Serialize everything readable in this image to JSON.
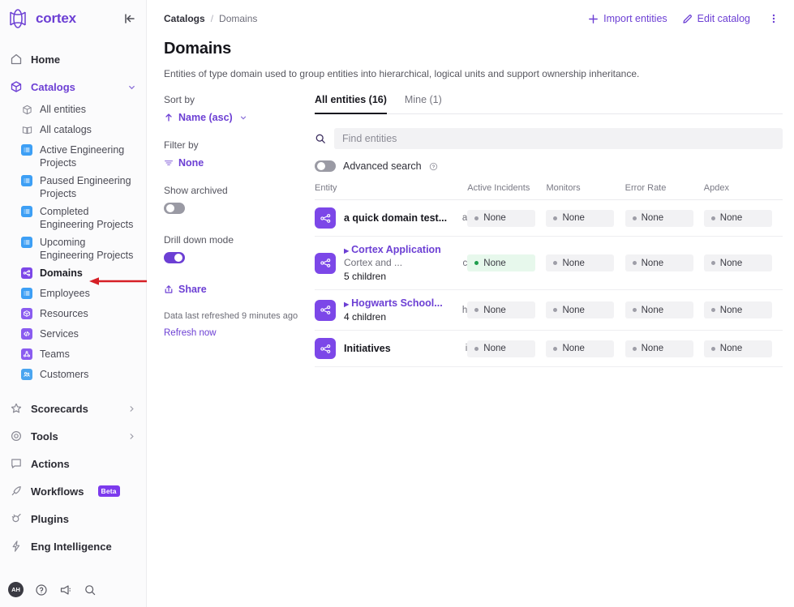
{
  "brand": {
    "name": "cortex",
    "collapse_icon": "collapse-left-icon"
  },
  "sidebar": {
    "home": {
      "label": "Home",
      "icon": "home-icon"
    },
    "catalogs": {
      "label": "Catalogs",
      "icon": "cube-icon",
      "chevron": "chevron-down-icon"
    },
    "catalog_items": [
      {
        "label": "All entities",
        "icon": "cube-outline-icon",
        "color": "none"
      },
      {
        "label": "All catalogs",
        "icon": "book-icon",
        "color": "none"
      },
      {
        "label": "Active Engineering Projects",
        "icon": "list-icon",
        "color": "#3d9ff5"
      },
      {
        "label": "Paused Engineering Projects",
        "icon": "list-icon",
        "color": "#3d9ff5"
      },
      {
        "label": "Completed Engineering Projects",
        "icon": "list-icon",
        "color": "#3d9ff5"
      },
      {
        "label": "Upcoming Engineering Projects",
        "icon": "list-icon",
        "color": "#3d9ff5"
      },
      {
        "label": "Domains",
        "icon": "domain-icon",
        "color": "#7c47e8"
      },
      {
        "label": "Employees",
        "icon": "list-icon",
        "color": "#3d9ff5"
      },
      {
        "label": "Resources",
        "icon": "cube-solid-icon",
        "color": "#8a5cf0"
      },
      {
        "label": "Services",
        "icon": "code-icon",
        "color": "#8a5cf0"
      },
      {
        "label": "Teams",
        "icon": "team-icon",
        "color": "#8a5cf0"
      },
      {
        "label": "Customers",
        "icon": "customers-icon",
        "color": "#4aa5f0"
      }
    ],
    "sections": [
      {
        "label": "Scorecards",
        "icon": "star-icon",
        "chevron": "chevron-right-icon"
      },
      {
        "label": "Tools",
        "icon": "gear-icon",
        "chevron": "chevron-right-icon"
      },
      {
        "label": "Actions",
        "icon": "actions-icon",
        "chevron": ""
      },
      {
        "label": "Workflows",
        "icon": "rocket-icon",
        "chevron": "",
        "badge": "Beta"
      },
      {
        "label": "Plugins",
        "icon": "plug-icon",
        "chevron": ""
      },
      {
        "label": "Eng Intelligence",
        "icon": "bolt-icon",
        "chevron": ""
      }
    ],
    "footer": {
      "avatar_initials": "AH",
      "icons": [
        "help-circle-icon",
        "megaphone-icon",
        "search-icon"
      ]
    }
  },
  "topbar": {
    "breadcrumb": {
      "first": "Catalogs",
      "separator": "/",
      "last": "Domains"
    },
    "import_label": "Import entities",
    "import_icon": "plus-icon",
    "edit_label": "Edit catalog",
    "edit_icon": "pencil-icon",
    "more_icon": "kebab-menu-icon"
  },
  "page": {
    "title": "Domains",
    "description": "Entities of type domain used to group entities into hierarchical, logical units and support ownership inheritance."
  },
  "rail": {
    "sort_by_label": "Sort by",
    "sort_by_value": "Name (asc)",
    "sort_by_icon": "arrow-up-icon",
    "filter_by_label": "Filter by",
    "filter_by_value": "None",
    "filter_by_icon": "filter-icon",
    "show_archived_label": "Show archived",
    "show_archived_state": "off",
    "drill_down_label": "Drill down mode",
    "drill_down_state": "on",
    "share_label": "Share",
    "share_icon": "share-icon",
    "refresh_note": "Data last refreshed 9 minutes ago",
    "refresh_link": "Refresh now"
  },
  "panel": {
    "tabs": [
      {
        "label": "All entities (16)",
        "active": true
      },
      {
        "label": "Mine (1)",
        "active": false
      }
    ],
    "search_placeholder": "Find entities",
    "search_value": "",
    "search_icon": "search-icon",
    "advanced_search_label": "Advanced search",
    "advanced_search_state": "off",
    "help_icon": "help-circle-icon",
    "columns": [
      "Entity",
      "Active Incidents",
      "Monitors",
      "Error Rate",
      "Apdex"
    ],
    "rows": [
      {
        "name": "a quick domain test...",
        "is_link": false,
        "sub": "",
        "children": "",
        "key": "a",
        "icon": "domain-icon",
        "active_incidents": "None",
        "monitors": "None",
        "error_rate": "None",
        "apdex": "None",
        "incident_status": "neutral"
      },
      {
        "name": "Cortex Application",
        "is_link": true,
        "sub": "Cortex and ...",
        "children": "5 children",
        "key": "c",
        "icon": "domain-icon",
        "active_incidents": "None",
        "monitors": "None",
        "error_rate": "None",
        "apdex": "None",
        "incident_status": "green"
      },
      {
        "name": "Hogwarts School...",
        "is_link": true,
        "sub": "",
        "children": "4 children",
        "key": "h",
        "icon": "domain-icon",
        "active_incidents": "None",
        "monitors": "None",
        "error_rate": "None",
        "apdex": "None",
        "incident_status": "neutral"
      },
      {
        "name": "Initiatives",
        "is_link": false,
        "sub": "",
        "children": "",
        "key": "i",
        "icon": "domain-icon",
        "active_incidents": "None",
        "monitors": "None",
        "error_rate": "None",
        "apdex": "None",
        "incident_status": "neutral"
      }
    ]
  },
  "annotation": {
    "arrow_color": "#d61f26",
    "points_to": "Domains"
  },
  "colors": {
    "accent": "#6c3fd4",
    "brand": "#6c3fd4",
    "entity_icon": "#7c47e8",
    "status_green": "#1f9d4d",
    "annotation_red": "#d61f26"
  }
}
